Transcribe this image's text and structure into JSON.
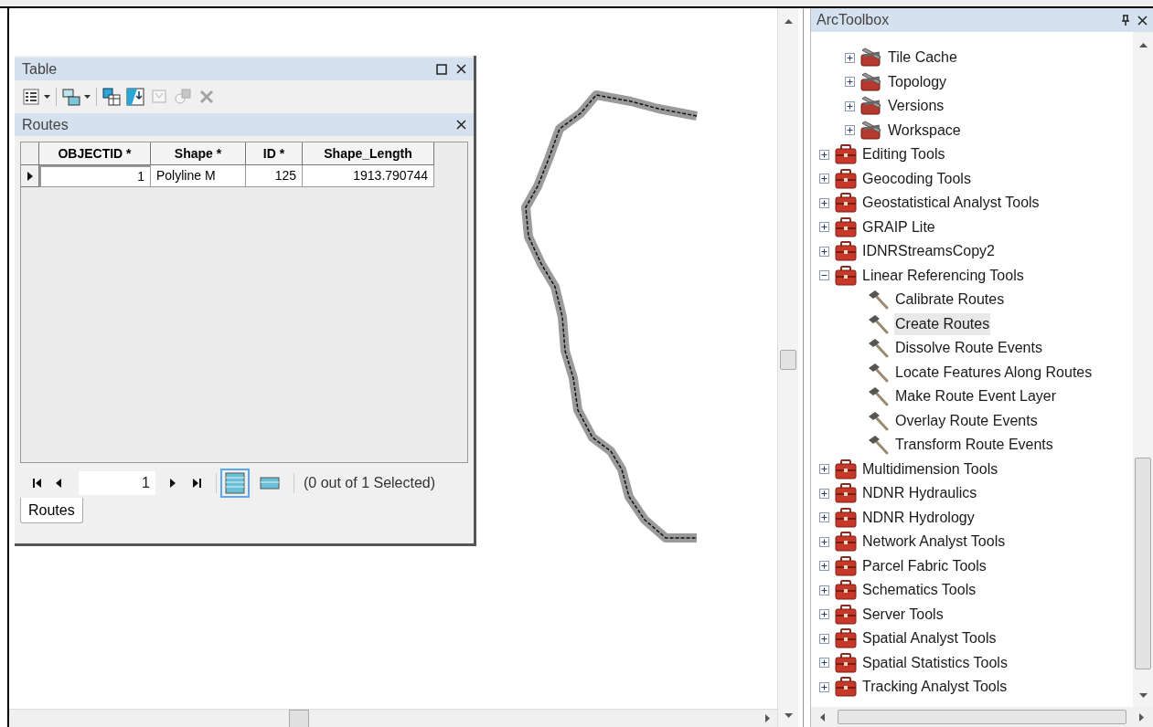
{
  "table_window": {
    "title": "Table",
    "toolbar": [
      {
        "kind": "table-options",
        "dropdown": true,
        "disabled": false
      },
      {
        "kind": "related-tables",
        "dropdown": true,
        "disabled": false
      },
      {
        "kind": "select-by-attributes",
        "dropdown": false,
        "disabled": false
      },
      {
        "kind": "switch-selection",
        "dropdown": false,
        "disabled": false
      },
      {
        "kind": "clear-selection",
        "dropdown": false,
        "disabled": true
      },
      {
        "kind": "zoom-to-selected",
        "dropdown": false,
        "disabled": true
      },
      {
        "kind": "delete-selected",
        "dropdown": false,
        "disabled": true
      }
    ],
    "table_title": "Routes",
    "columns": [
      "OBJECTID *",
      "Shape *",
      "ID *",
      "Shape_Length"
    ],
    "rows": [
      {
        "current": true,
        "cells": [
          "1",
          "Polyline M",
          "125",
          "1913.790744"
        ]
      }
    ],
    "record": "1",
    "views": [
      {
        "kind": "all",
        "selected": true
      },
      {
        "kind": "selected",
        "selected": false
      }
    ],
    "status": "(0 out of 1 Selected)",
    "tabs": [
      {
        "label": "Routes",
        "selected": true
      }
    ]
  },
  "toolbox": {
    "title": "ArcToolbox",
    "continued_children": [
      {
        "label": "Tile Cache",
        "kind": "toolset",
        "expanded": false
      },
      {
        "label": "Topology",
        "kind": "toolset",
        "expanded": false
      },
      {
        "label": "Versions",
        "kind": "toolset",
        "expanded": false
      },
      {
        "label": "Workspace",
        "kind": "toolset",
        "expanded": false
      }
    ],
    "items": [
      {
        "label": "Editing Tools",
        "kind": "toolbox",
        "expanded": false
      },
      {
        "label": "Geocoding Tools",
        "kind": "toolbox",
        "expanded": false
      },
      {
        "label": "Geostatistical Analyst Tools",
        "kind": "toolbox",
        "expanded": false
      },
      {
        "label": "GRAIP Lite",
        "kind": "toolbox",
        "expanded": false
      },
      {
        "label": "IDNRStreamsCopy2",
        "kind": "toolbox",
        "expanded": false
      },
      {
        "label": "Linear Referencing Tools",
        "kind": "toolbox",
        "expanded": true,
        "children": [
          {
            "label": "Calibrate Routes",
            "kind": "tool",
            "selected": false
          },
          {
            "label": "Create Routes",
            "kind": "tool",
            "selected": true
          },
          {
            "label": "Dissolve Route Events",
            "kind": "tool",
            "selected": false
          },
          {
            "label": "Locate Features Along Routes",
            "kind": "tool",
            "selected": false
          },
          {
            "label": "Make Route Event Layer",
            "kind": "tool",
            "selected": false
          },
          {
            "label": "Overlay Route Events",
            "kind": "tool",
            "selected": false
          },
          {
            "label": "Transform Route Events",
            "kind": "tool",
            "selected": false
          }
        ]
      },
      {
        "label": "Multidimension Tools",
        "kind": "toolbox",
        "expanded": false
      },
      {
        "label": "NDNR Hydraulics",
        "kind": "toolbox",
        "expanded": false
      },
      {
        "label": "NDNR Hydrology",
        "kind": "toolbox",
        "expanded": false
      },
      {
        "label": "Network Analyst Tools",
        "kind": "toolbox",
        "expanded": false
      },
      {
        "label": "Parcel Fabric Tools",
        "kind": "toolbox",
        "expanded": false
      },
      {
        "label": "Schematics Tools",
        "kind": "toolbox",
        "expanded": false
      },
      {
        "label": "Server Tools",
        "kind": "toolbox",
        "expanded": false
      },
      {
        "label": "Spatial Analyst Tools",
        "kind": "toolbox",
        "expanded": false
      },
      {
        "label": "Spatial Statistics Tools",
        "kind": "toolbox",
        "expanded": false
      },
      {
        "label": "Tracking Analyst Tools",
        "kind": "toolbox",
        "expanded": false
      }
    ]
  }
}
